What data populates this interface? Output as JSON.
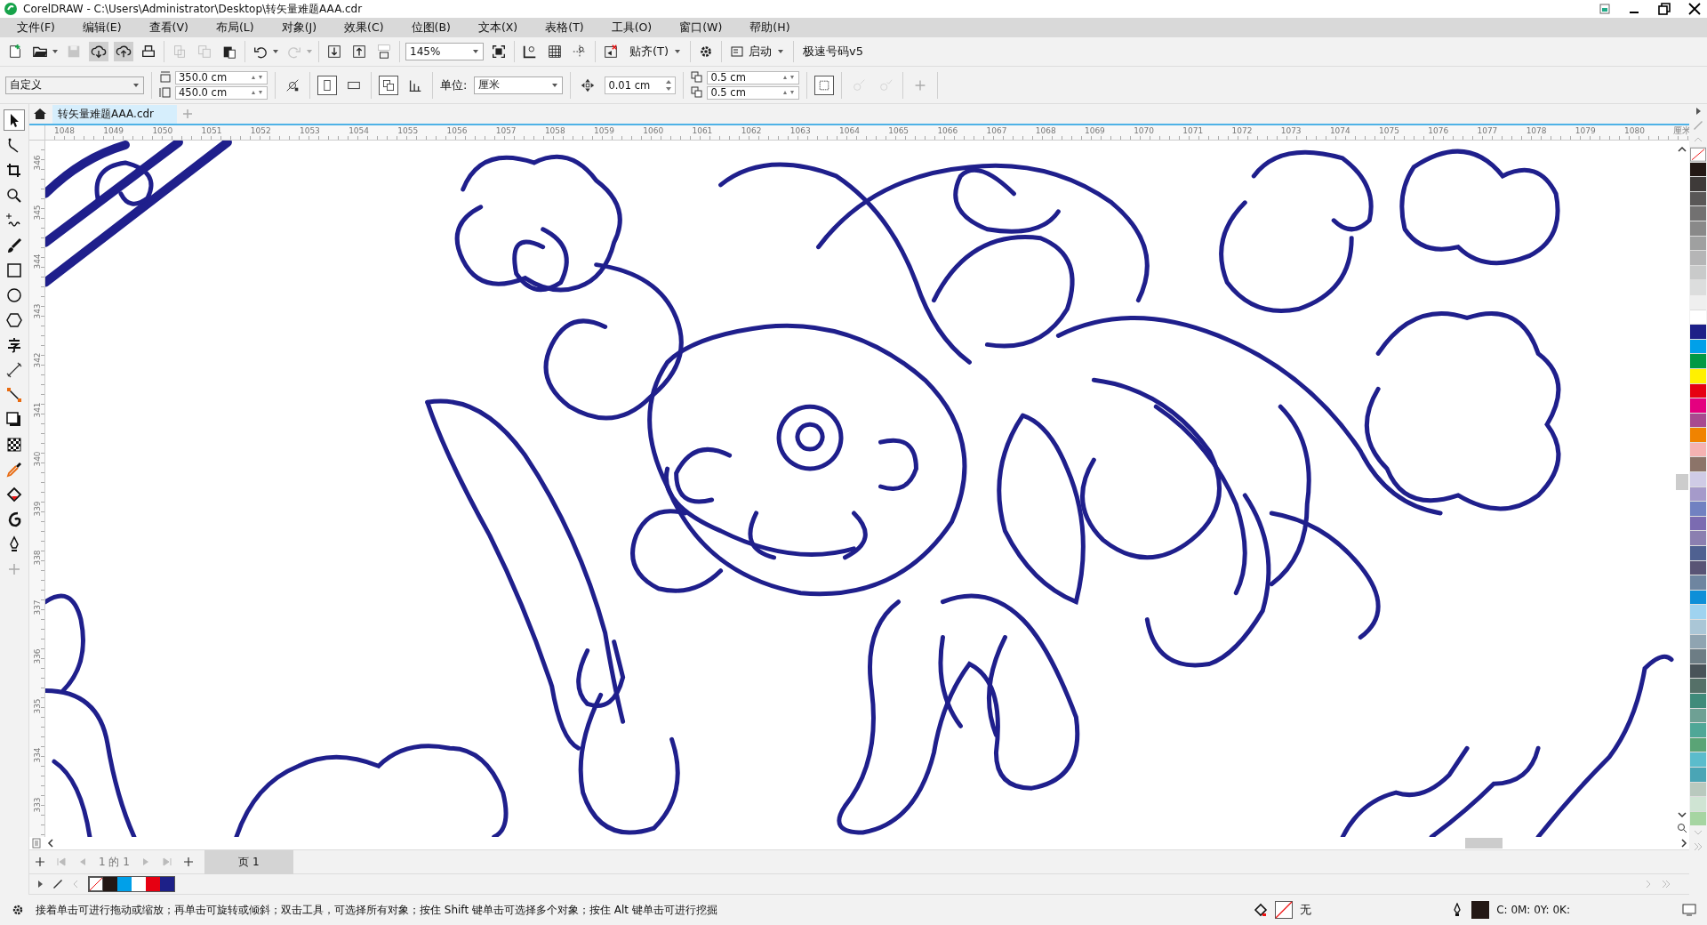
{
  "window": {
    "title": "CorelDRAW - C:\\Users\\Administrator\\Desktop\\转矢量难题AAA.cdr"
  },
  "menu": [
    "文件(F)",
    "编辑(E)",
    "查看(V)",
    "布局(L)",
    "对象(J)",
    "效果(C)",
    "位图(B)",
    "文本(X)",
    "表格(T)",
    "工具(O)",
    "窗口(W)",
    "帮助(H)"
  ],
  "toolbar": {
    "zoom": "145%",
    "snap": "贴齐(T)",
    "launch": "启动",
    "plugin": "极速号码v5"
  },
  "property_bar": {
    "preset": "自定义",
    "width": "350.0 cm",
    "height": "450.0 cm",
    "unit_label": "单位:",
    "unit": "厘米",
    "nudge": "0.01 cm",
    "dup_x": "0.5 cm",
    "dup_y": "0.5 cm"
  },
  "document_tabs": [
    {
      "label": "转矢量难题AAA.cdr",
      "selected": true
    }
  ],
  "horizontal_ruler": {
    "ticks": [
      "1048",
      "1049",
      "1050",
      "1051",
      "1052",
      "1053",
      "1054",
      "1055",
      "1056",
      "1057",
      "1058",
      "1059",
      "1060",
      "1061",
      "1062",
      "1063",
      "1064",
      "1065",
      "1066",
      "1067",
      "1068",
      "1069",
      "1070",
      "1071",
      "1072",
      "1073",
      "1074",
      "1075",
      "1076",
      "1077",
      "1078",
      "1079",
      "1080"
    ],
    "unit": "厘米"
  },
  "vertical_ruler": {
    "ticks": [
      "346",
      "345",
      "344",
      "343",
      "342",
      "341",
      "340",
      "339",
      "338",
      "337",
      "336",
      "335",
      "334",
      "333"
    ]
  },
  "page_navigator": {
    "count": "1 的 1",
    "pages": [
      {
        "label": "页 1",
        "selected": true
      }
    ]
  },
  "document_palette": [
    {
      "kind": "none"
    },
    {
      "kind": "swatch",
      "color": "#231815"
    },
    {
      "kind": "swatch",
      "color": "#00a0e9"
    },
    {
      "kind": "swatch",
      "color": "#ffffff"
    },
    {
      "kind": "swatch",
      "color": "#e60012"
    },
    {
      "kind": "swatch",
      "color": "#1d2088"
    }
  ],
  "color_palette": [
    {
      "kind": "none"
    },
    {
      "kind": "swatch",
      "color": "#231815"
    },
    {
      "kind": "swatch",
      "color": "#3e3a39"
    },
    {
      "kind": "swatch",
      "color": "#595757"
    },
    {
      "kind": "swatch",
      "color": "#727171"
    },
    {
      "kind": "swatch",
      "color": "#898989"
    },
    {
      "kind": "swatch",
      "color": "#9fa0a0"
    },
    {
      "kind": "swatch",
      "color": "#b5b5b6"
    },
    {
      "kind": "swatch",
      "color": "#c9caca"
    },
    {
      "kind": "swatch",
      "color": "#dcdddd"
    },
    {
      "kind": "swatch",
      "color": "#efefef"
    },
    {
      "kind": "swatch",
      "color": "#ffffff"
    },
    {
      "kind": "swatch",
      "color": "#1d2088"
    },
    {
      "kind": "swatch",
      "color": "#00a0e9"
    },
    {
      "kind": "swatch",
      "color": "#009944"
    },
    {
      "kind": "swatch",
      "color": "#fff100"
    },
    {
      "kind": "swatch",
      "color": "#e60012"
    },
    {
      "kind": "swatch",
      "color": "#e4007f"
    },
    {
      "kind": "swatch",
      "color": "#a84a8f"
    },
    {
      "kind": "swatch",
      "color": "#f08300"
    },
    {
      "kind": "swatch",
      "color": "#f5b2b2"
    },
    {
      "kind": "swatch",
      "color": "#8c7469"
    },
    {
      "kind": "swatch",
      "color": "#cfcbe6"
    },
    {
      "kind": "swatch",
      "color": "#a59aca"
    },
    {
      "kind": "swatch",
      "color": "#7181c1"
    },
    {
      "kind": "swatch",
      "color": "#7b6bb1"
    },
    {
      "kind": "swatch",
      "color": "#8b7fb0"
    },
    {
      "kind": "swatch",
      "color": "#4f6191"
    },
    {
      "kind": "swatch",
      "color": "#595475"
    },
    {
      "kind": "swatch",
      "color": "#6e85a0"
    },
    {
      "kind": "swatch",
      "color": "#0e8fd8"
    },
    {
      "kind": "swatch",
      "color": "#9fd3f0"
    },
    {
      "kind": "swatch",
      "color": "#aac6d6"
    },
    {
      "kind": "swatch",
      "color": "#8fa4b1"
    },
    {
      "kind": "swatch",
      "color": "#6d7d85"
    },
    {
      "kind": "swatch",
      "color": "#495359"
    },
    {
      "kind": "swatch",
      "color": "#557068"
    },
    {
      "kind": "swatch",
      "color": "#3f8b7a"
    },
    {
      "kind": "swatch",
      "color": "#6ea094"
    },
    {
      "kind": "swatch",
      "color": "#4fa797"
    },
    {
      "kind": "swatch",
      "color": "#5aa476"
    },
    {
      "kind": "swatch",
      "color": "#5bbccc"
    },
    {
      "kind": "swatch",
      "color": "#4aa5b5"
    },
    {
      "kind": "swatch",
      "color": "#b9c9be"
    },
    {
      "kind": "swatch",
      "color": "#cfe4d3"
    },
    {
      "kind": "swatch",
      "color": "#a6d5a2"
    }
  ],
  "status_bar": {
    "hint": "接着单击可进行拖动或缩放；再单击可旋转或倾斜；双击工具，可选择所有对象；按住 Shift 键单击可选择多个对象；按住 Alt 键单击可进行挖掘",
    "fill": {
      "kind": "none",
      "label": "无"
    },
    "outline": {
      "color": "#231815",
      "label": "C:  0M:  0Y:  0K:"
    }
  }
}
